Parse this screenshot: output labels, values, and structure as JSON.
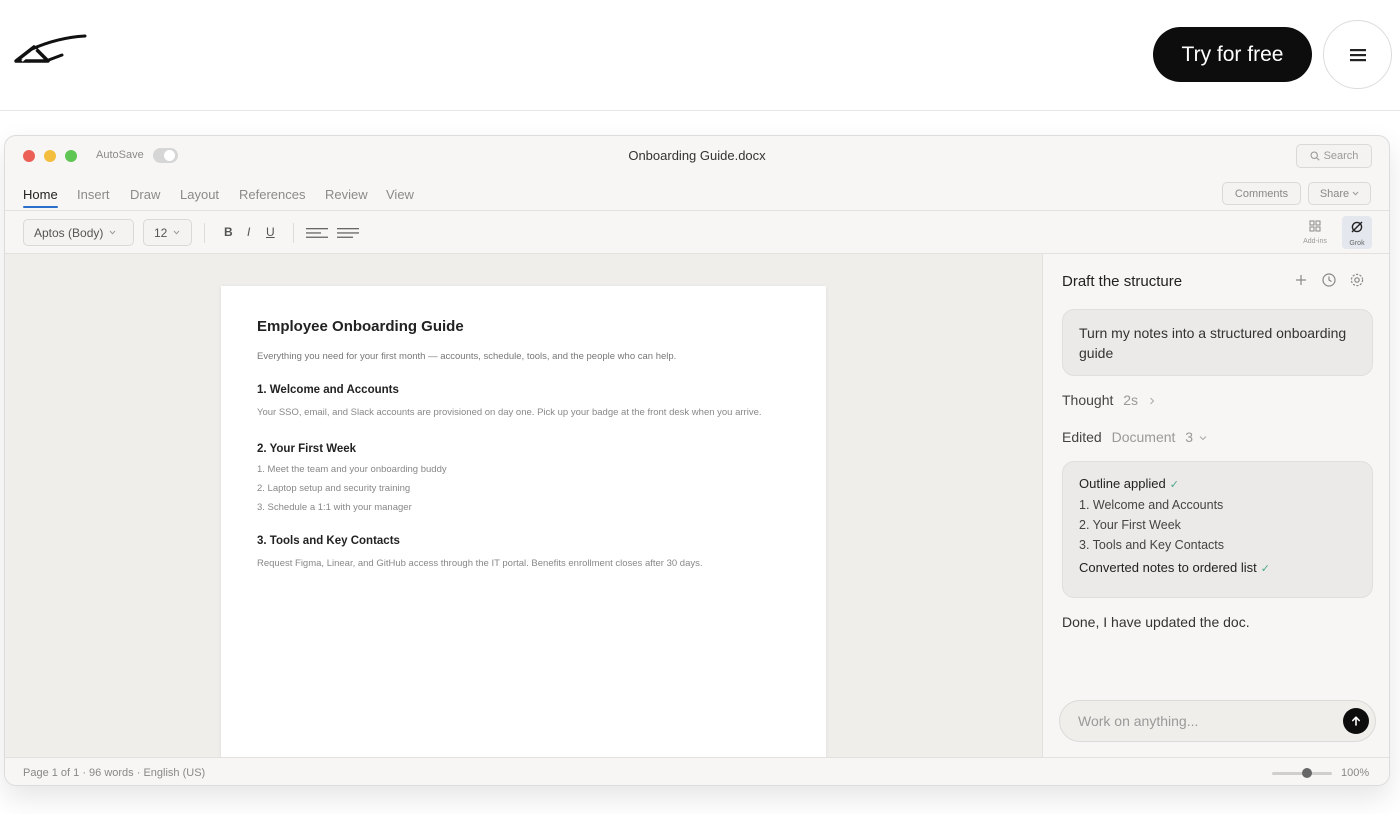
{
  "site": {
    "logo": "x-logo-icon",
    "try_label": "Try for free",
    "menu_icon": "hamburger-menu-icon"
  },
  "window": {
    "autosave_label": "AutoSave",
    "title": "Onboarding Guide.docx",
    "search_label": "Search"
  },
  "ribbon": {
    "tabs": [
      "Home",
      "Insert",
      "Draw",
      "Layout",
      "References",
      "Review",
      "View"
    ],
    "active_tab": "Home",
    "comments_label": "Comments",
    "share_label": "Share"
  },
  "toolbar": {
    "font": "Aptos (Body)",
    "size": "12",
    "bold": "B",
    "italic": "I",
    "underline": "U",
    "addins_label": "Add-ins",
    "grok_label": "Grok"
  },
  "document": {
    "title": "Employee Onboarding Guide",
    "lead": "Everything you need for your first month — accounts, schedule, tools, and the people who can help.",
    "s1_heading": "1. Welcome and Accounts",
    "s1_body": "Your SSO, email, and Slack accounts are provisioned on day one. Pick up your badge at the front desk when you arrive.",
    "s2_heading": "2. Your First Week",
    "s2_items": [
      "1. Meet the team and your onboarding buddy",
      "2. Laptop setup and security training",
      "3. Schedule a 1:1 with your manager"
    ],
    "s3_heading": "3. Tools and Key Contacts",
    "s3_body": "Request Figma, Linear, and GitHub access through the IT portal. Benefits enrollment closes after 30 days."
  },
  "assistant": {
    "title": "Draft the structure",
    "prompt": "Turn my notes into a structured onboarding guide",
    "thought_label": "Thought",
    "thought_time": "2s",
    "edited_label": "Edited",
    "edited_target": "Document",
    "edited_count": "3",
    "outline_head": "Outline applied",
    "outline_items": [
      "1. Welcome and Accounts",
      "2. Your First Week",
      "3. Tools and Key Contacts"
    ],
    "outline_foot": "Converted notes to ordered list",
    "done": "Done, I have updated the doc.",
    "input_placeholder": "Work on anything..."
  },
  "status": {
    "text": "Page 1 of 1 · 96 words · English (US)",
    "zoom": "100%"
  }
}
